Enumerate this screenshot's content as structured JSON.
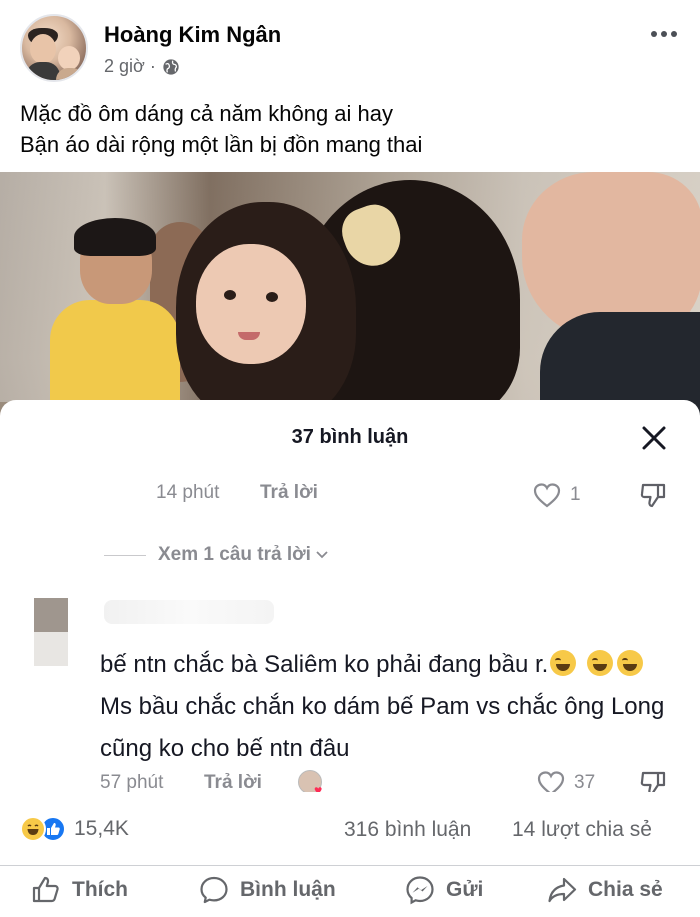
{
  "post": {
    "author": "Hoàng Kim Ngân",
    "time": "2 giờ ·",
    "caption_line1": "Mặc đồ ôm dáng cả năm không ai hay",
    "caption_line2": "Bận áo dài rộng một lần bị đồn mang thai"
  },
  "comments_sheet": {
    "title": "37 bình luận",
    "reply1": {
      "time": "14 phút",
      "reply_label": "Trả lời",
      "likes": "1"
    },
    "view_replies": "Xem 1 câu trả lời",
    "comment2": {
      "text_part1": "bế ntn chắc bà Saliêm ko phải đang bầu r.",
      "text_part2": "Ms bầu chắc chắn ko dám bế Pam vs chắc ông Long cũng ko cho bế ntn đâu",
      "time": "57 phút",
      "reply_label": "Trả lời",
      "likes": "37"
    }
  },
  "stats": {
    "reactions_count": "15,4K",
    "comments": "316 bình luận",
    "shares": "14 lượt chia sẻ"
  },
  "actions": {
    "like": "Thích",
    "comment": "Bình luận",
    "send": "Gửi",
    "share": "Chia sẻ"
  },
  "colors": {
    "facebook_blue": "#1877f2",
    "text_grey": "#65676b",
    "tiktok_grey": "#8a8b91",
    "haha_yellow": "#f7c948"
  }
}
